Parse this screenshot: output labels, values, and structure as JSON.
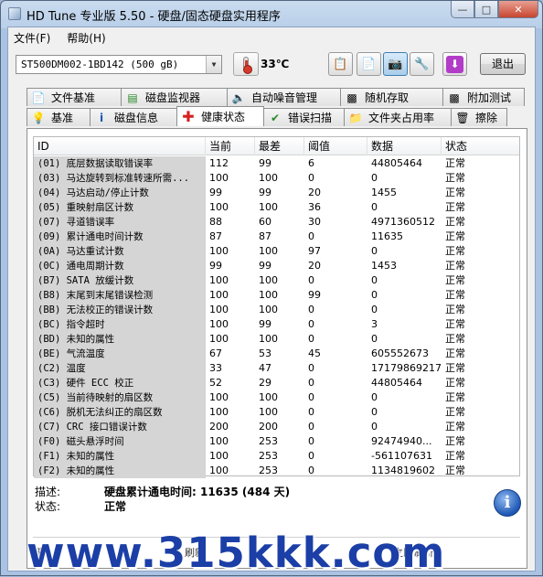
{
  "window": {
    "title": "HD Tune 专业版 5.50 - 硬盘/固态硬盘实用程序"
  },
  "menu": [
    "文件(F)",
    "帮助(H)"
  ],
  "toolbar": {
    "drive": "ST500DM002-1BD142 (500 gB)",
    "temperature": "33℃",
    "exit_label": "退出"
  },
  "tabs_top": [
    {
      "label": "文件基准",
      "icon": "file-benchmark-icon"
    },
    {
      "label": "磁盘监视器",
      "icon": "disk-monitor-icon"
    },
    {
      "label": "自动噪音管理",
      "icon": "speaker-icon"
    },
    {
      "label": "随机存取",
      "icon": "random-access-icon"
    },
    {
      "label": "附加测试",
      "icon": "extra-tests-icon"
    }
  ],
  "tabs_bottom": [
    {
      "label": "基准",
      "icon": "benchmark-icon"
    },
    {
      "label": "磁盘信息",
      "icon": "info-icon"
    },
    {
      "label": "健康状态",
      "icon": "health-cross-icon"
    },
    {
      "label": "错误扫描",
      "icon": "error-scan-icon"
    },
    {
      "label": "文件夹占用率",
      "icon": "folder-icon"
    },
    {
      "label": "擦除",
      "icon": "trash-icon"
    }
  ],
  "table": {
    "headers": [
      "ID",
      "当前",
      "最差",
      "阈值",
      "数据",
      "状态"
    ],
    "rows": [
      [
        "(01) 底层数据读取错误率",
        "112",
        "99",
        "6",
        "44805464",
        "正常"
      ],
      [
        "(03) 马达旋转到标准转速所需...",
        "100",
        "100",
        "0",
        "0",
        "正常"
      ],
      [
        "(04) 马达启动/停止计数",
        "99",
        "99",
        "20",
        "1455",
        "正常"
      ],
      [
        "(05) 重映射扇区计数",
        "100",
        "100",
        "36",
        "0",
        "正常"
      ],
      [
        "(07) 寻道错误率",
        "88",
        "60",
        "30",
        "4971360512",
        "正常"
      ],
      [
        "(09) 累计通电时间计数",
        "87",
        "87",
        "0",
        "11635",
        "正常"
      ],
      [
        "(0A) 马达重试计数",
        "100",
        "100",
        "97",
        "0",
        "正常"
      ],
      [
        "(0C) 通电周期计数",
        "99",
        "99",
        "20",
        "1453",
        "正常"
      ],
      [
        "(B7) SATA 放缓计数",
        "100",
        "100",
        "0",
        "0",
        "正常"
      ],
      [
        "(B8) 末尾到末尾错误检测",
        "100",
        "100",
        "99",
        "0",
        "正常"
      ],
      [
        "(BB) 无法校正的错误计数",
        "100",
        "100",
        "0",
        "0",
        "正常"
      ],
      [
        "(BC) 指令超时",
        "100",
        "99",
        "0",
        "3",
        "正常"
      ],
      [
        "(BD) 未知的属性",
        "100",
        "100",
        "0",
        "0",
        "正常"
      ],
      [
        "(BE) 气流温度",
        "67",
        "53",
        "45",
        "605552673",
        "正常"
      ],
      [
        "(C2) 温度",
        "33",
        "47",
        "0",
        "17179869217",
        "正常"
      ],
      [
        "(C3) 硬件 ECC 校正",
        "52",
        "29",
        "0",
        "44805464",
        "正常"
      ],
      [
        "(C5) 当前待映射的扇区数",
        "100",
        "100",
        "0",
        "0",
        "正常"
      ],
      [
        "(C6) 脱机无法纠正的扇区数",
        "100",
        "100",
        "0",
        "0",
        "正常"
      ],
      [
        "(C7) CRC 接口错误计数",
        "200",
        "200",
        "0",
        "0",
        "正常"
      ],
      [
        "(F0) 磁头悬浮时间",
        "100",
        "253",
        "0",
        "92474940...",
        "正常"
      ],
      [
        "(F1) 未知的属性",
        "100",
        "253",
        "0",
        "-561107631",
        "正常"
      ],
      [
        "(F2) 未知的属性",
        "100",
        "253",
        "0",
        "1134819602",
        "正常"
      ]
    ]
  },
  "details": {
    "description_label": "描述:",
    "description_value": "硬盘累计通电时间: 11635 (484 天)",
    "status_label": "状态:",
    "status_value": "正常"
  },
  "bottom": {
    "left": "健",
    "mid": "刷新",
    "right": "立即刷新"
  },
  "watermark": "www.315kkk.com"
}
